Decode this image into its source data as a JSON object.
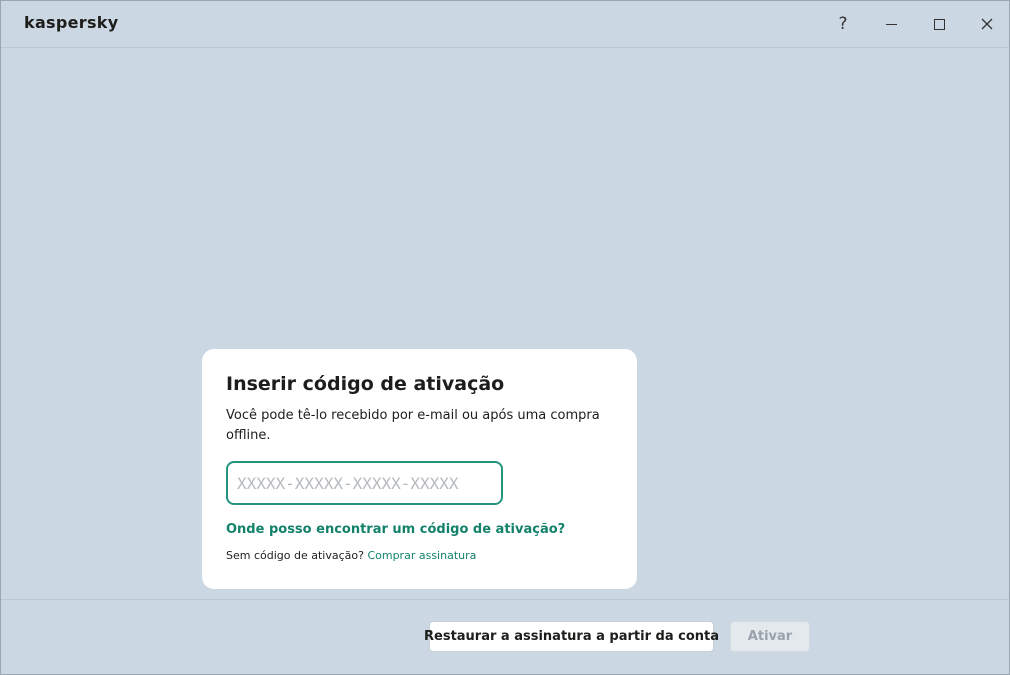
{
  "app": {
    "logo": "kaspersky",
    "help_symbol": "?"
  },
  "card": {
    "title": "Inserir código de ativação",
    "description": "Você pode tê-lo recebido por e-mail ou após uma compra offline.",
    "input_placeholder": "XXXXX-XXXXX-XXXXX-XXXXX",
    "input_value": "",
    "help_link": "Onde posso encontrar um código de ativação?",
    "no_code_text": "Sem código de ativação?",
    "buy_link": "Comprar assinatura"
  },
  "footer": {
    "restore_label": "Restaurar a assinatura a partir da conta",
    "activate_label": "Ativar"
  },
  "colors": {
    "accent": "#13826b",
    "background": "#cbd8e3",
    "disabled_button": "#e4e9ed"
  }
}
